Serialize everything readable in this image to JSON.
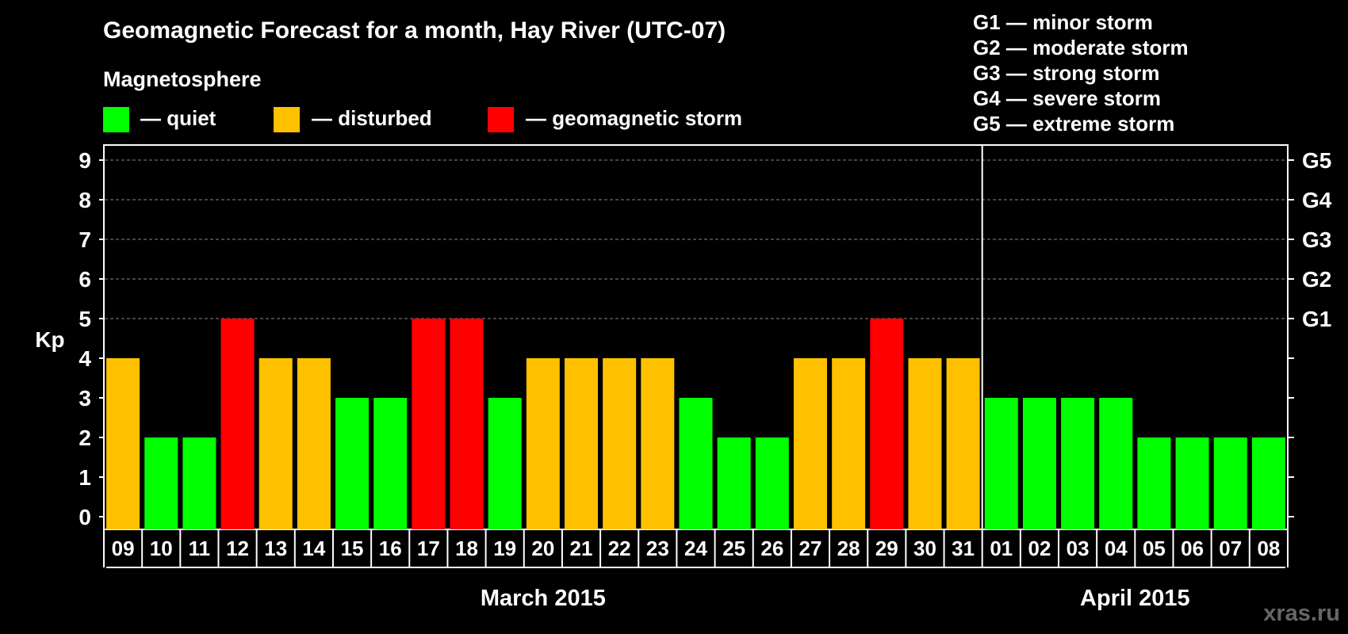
{
  "chart_data": {
    "type": "bar",
    "title": "Geomagnetic Forecast for a month, Hay River (UTC-07)",
    "subtitle": "Magnetosphere",
    "legend": [
      {
        "label": "— quiet",
        "color": "#00ff00"
      },
      {
        "label": "— disturbed",
        "color": "#ffc000"
      },
      {
        "label": "— geomagnetic storm",
        "color": "#ff0000"
      }
    ],
    "g_scale": [
      "G1 — minor storm",
      "G2 — moderate storm",
      "G3 — strong storm",
      "G4 — severe storm",
      "G5 — extreme storm"
    ],
    "ylabel": "Kp",
    "ylim": [
      0,
      9
    ],
    "yticks": [
      "0",
      "1",
      "2",
      "3",
      "4",
      "5",
      "6",
      "7",
      "8",
      "9"
    ],
    "right_ticks": [
      {
        "kp": 5,
        "label": "G1"
      },
      {
        "kp": 6,
        "label": "G2"
      },
      {
        "kp": 7,
        "label": "G3"
      },
      {
        "kp": 8,
        "label": "G4"
      },
      {
        "kp": 9,
        "label": "G5"
      }
    ],
    "grid": "dashed horizontal at Kp 5–9",
    "categories": [
      "09",
      "10",
      "11",
      "12",
      "13",
      "14",
      "15",
      "16",
      "17",
      "18",
      "19",
      "20",
      "21",
      "22",
      "23",
      "24",
      "25",
      "26",
      "27",
      "28",
      "29",
      "30",
      "31",
      "01",
      "02",
      "03",
      "04",
      "05",
      "06",
      "07",
      "08"
    ],
    "values": [
      4,
      2,
      2,
      5,
      4,
      4,
      3,
      3,
      5,
      5,
      3,
      4,
      4,
      4,
      4,
      3,
      2,
      2,
      4,
      4,
      5,
      4,
      4,
      3,
      3,
      3,
      3,
      2,
      2,
      2,
      2
    ],
    "months": [
      {
        "label": "March 2015",
        "first_index": 0,
        "last_index": 22
      },
      {
        "label": "April 2015",
        "first_index": 23,
        "last_index": 30
      }
    ],
    "colors": {
      "quiet": "#00ff00",
      "disturbed": "#ffc000",
      "storm": "#ff0000"
    }
  },
  "watermark": "xras.ru"
}
